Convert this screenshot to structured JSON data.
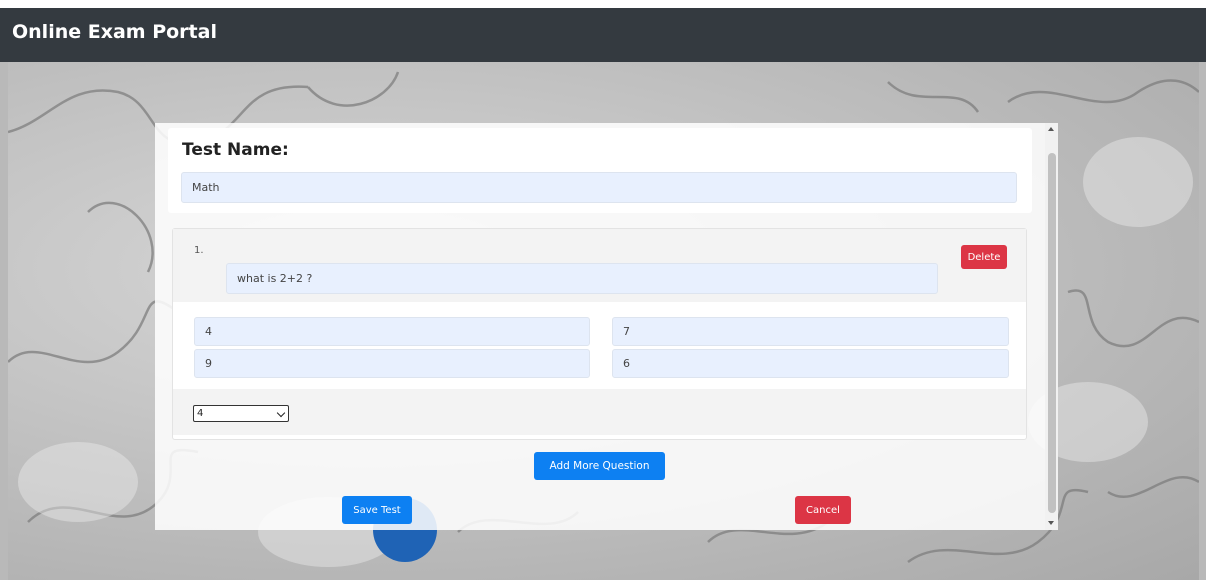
{
  "navbar": {
    "brand": "Online Exam Portal"
  },
  "form": {
    "test_name_label": "Test Name:",
    "test_name_value": "Math",
    "questions": [
      {
        "number": "1.",
        "text": "what is 2+2 ?",
        "delete_label": "Delete",
        "options": [
          "4",
          "7",
          "9",
          "6"
        ],
        "answer": "4"
      }
    ],
    "add_label": "Add More Question",
    "save_label": "Save Test",
    "cancel_label": "Cancel"
  },
  "colors": {
    "navbar": "#343a40",
    "primary": "#0d80f2",
    "danger": "#dc3545",
    "input_bg": "#e8f0fe"
  }
}
